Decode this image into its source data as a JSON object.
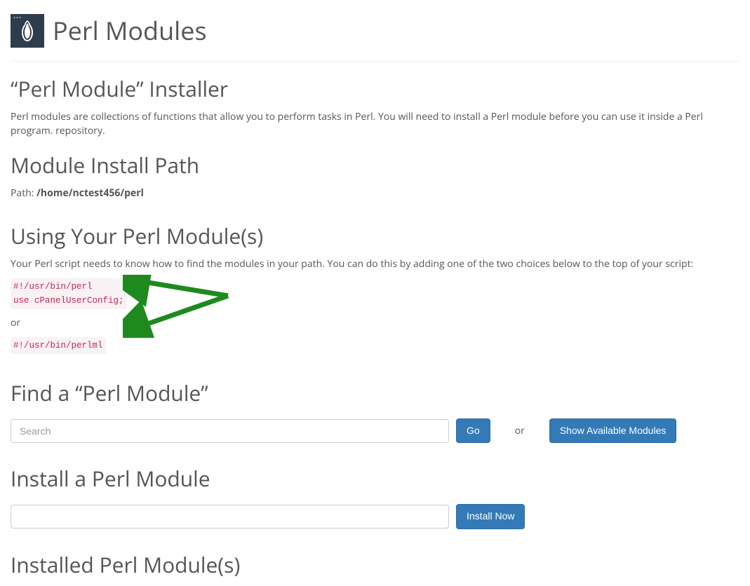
{
  "page": {
    "title": "Perl Modules"
  },
  "installer": {
    "heading": "“Perl Module” Installer",
    "description": "Perl modules are collections of functions that allow you to perform tasks in Perl. You will need to install a Perl module before you can use it inside a Perl program. repository."
  },
  "install_path": {
    "heading": "Module Install Path",
    "label": "Path: ",
    "value": "/home/nctest456/perl"
  },
  "using": {
    "heading": "Using Your Perl Module(s)",
    "description": "Your Perl script needs to know how to find the modules in your path. You can do this by adding one of the two choices below to the top of your script:",
    "code1": "#!/usr/bin/perl\nuse cPanelUserConfig;",
    "or": "or",
    "code2": "#!/usr/bin/perlml"
  },
  "find": {
    "heading": "Find a “Perl Module”",
    "search_placeholder": "Search",
    "go_btn": "Go",
    "or": "or",
    "show_btn": "Show Available Modules"
  },
  "install": {
    "heading": "Install a Perl Module",
    "install_btn": "Install Now"
  },
  "installed": {
    "heading": "Installed Perl Module(s)"
  }
}
